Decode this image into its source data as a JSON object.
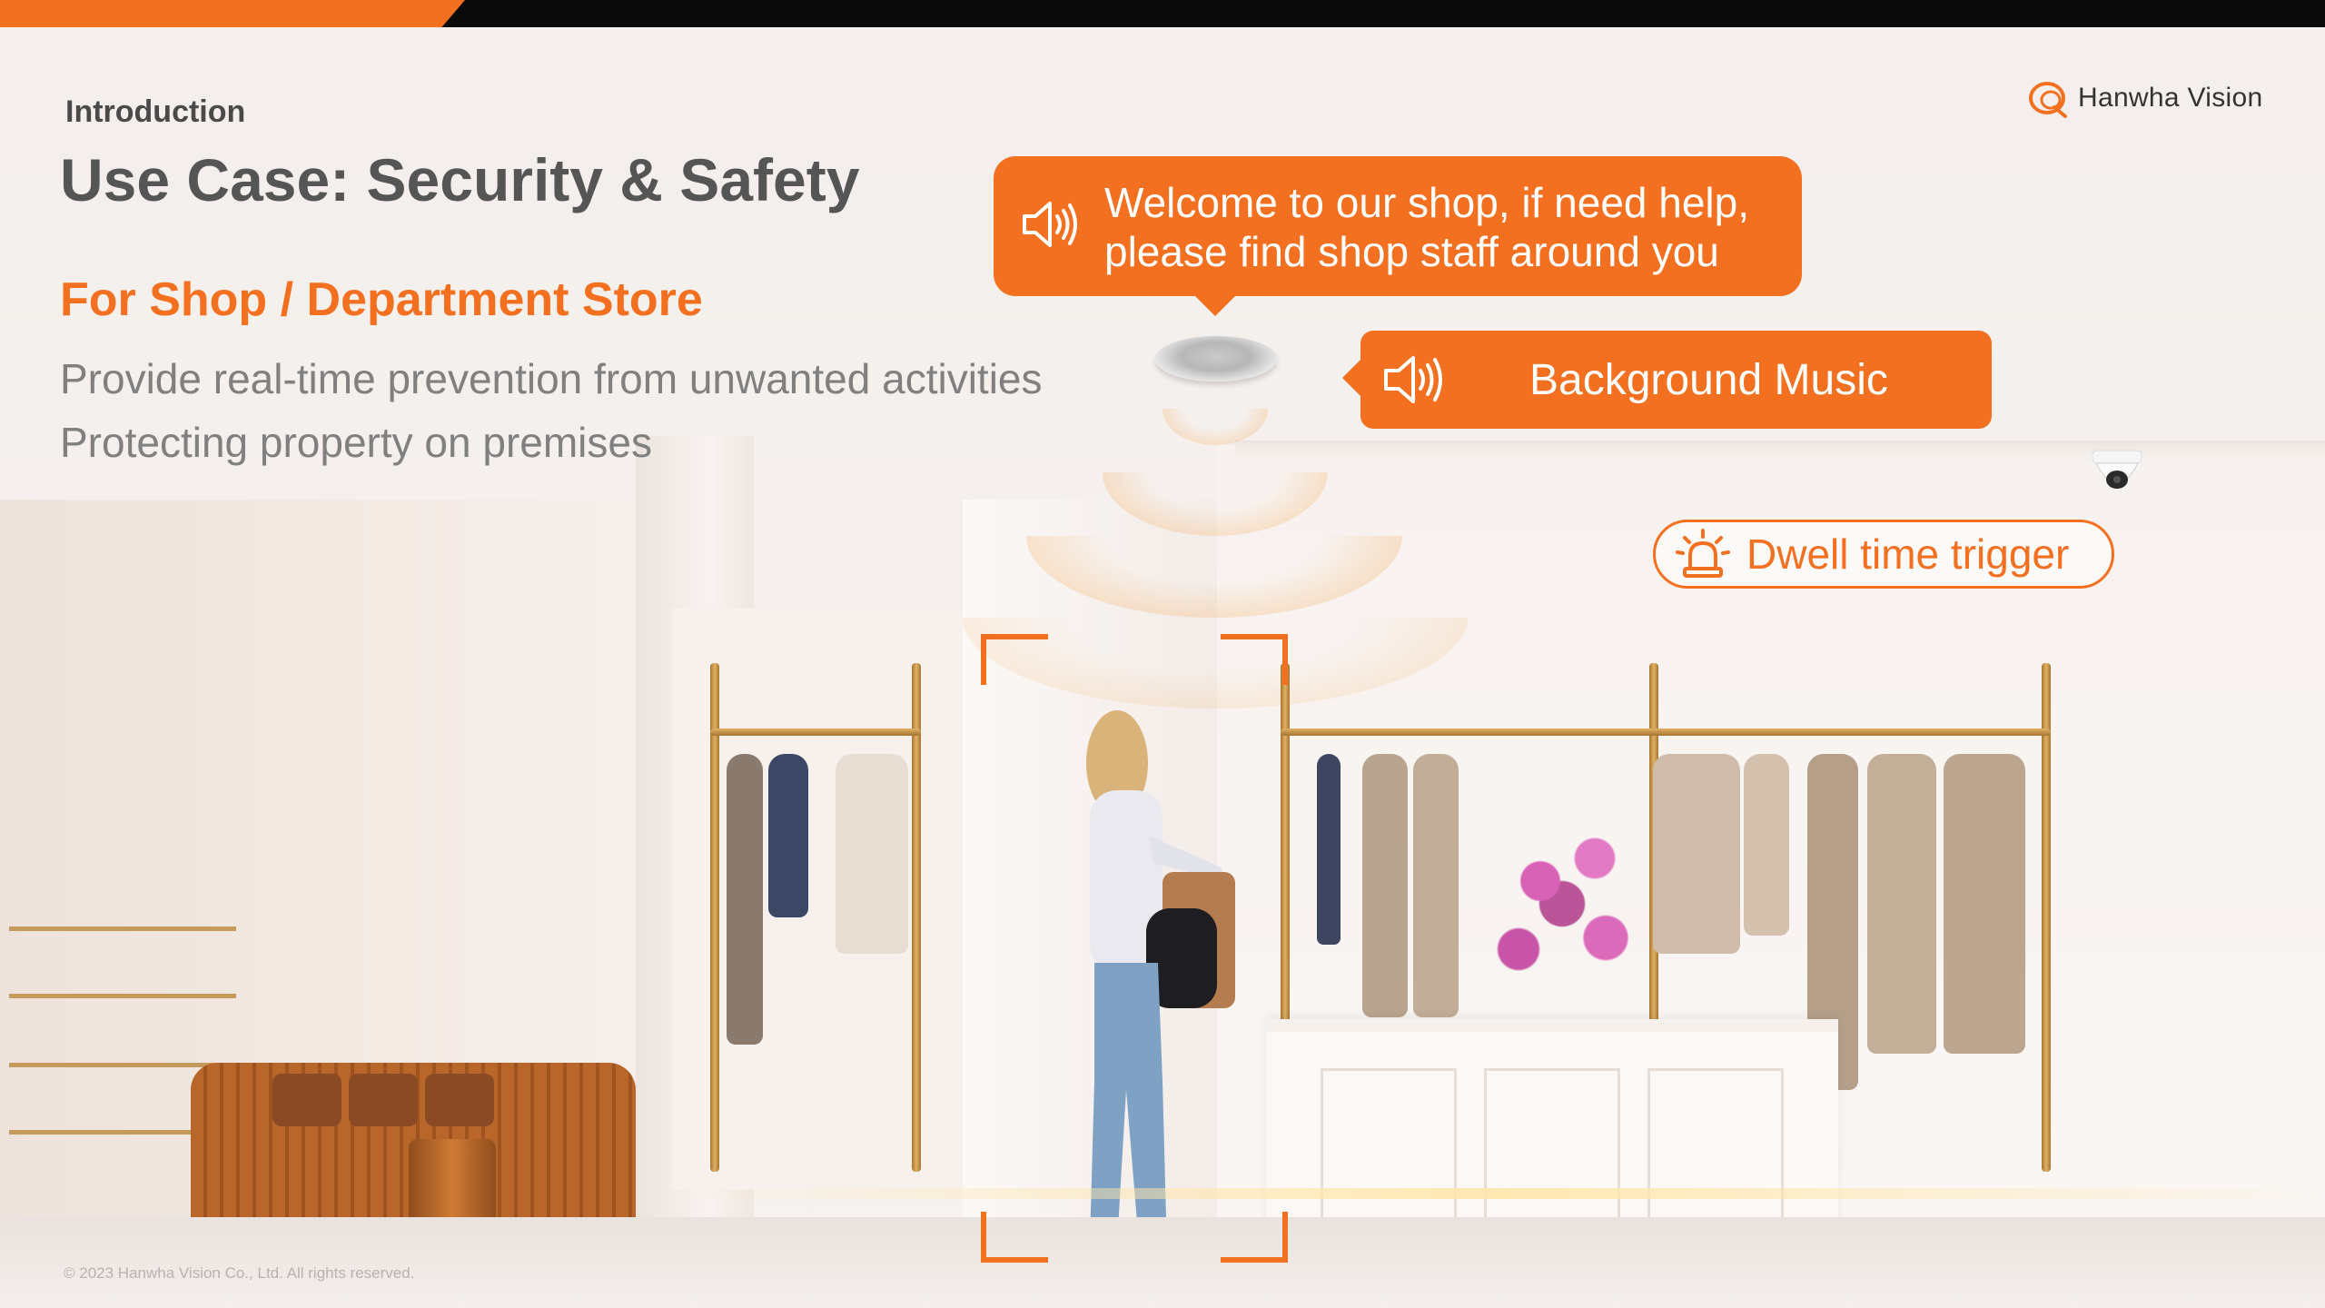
{
  "header": {
    "section_label": "Introduction",
    "title": "Use Case: Security & Safety",
    "subtitle": "For Shop / Department Store",
    "description_lines": [
      "Provide real-time prevention from unwanted activities",
      "Protecting property on premises"
    ]
  },
  "brand": {
    "logo_text": "Hanwha Vision",
    "accent_color": "#f37021"
  },
  "callouts": {
    "welcome_message": "Welcome to our shop, if need help, please find shop staff around you",
    "background_music": "Background Music",
    "dwell_time_trigger": "Dwell time trigger"
  },
  "icons": {
    "speaker": "speaker-icon",
    "alarm": "alarm-light-icon",
    "logo": "hanwha-logo-icon"
  },
  "footer": {
    "copyright": "© 2023 Hanwha Vision Co., Ltd. All rights reserved."
  }
}
